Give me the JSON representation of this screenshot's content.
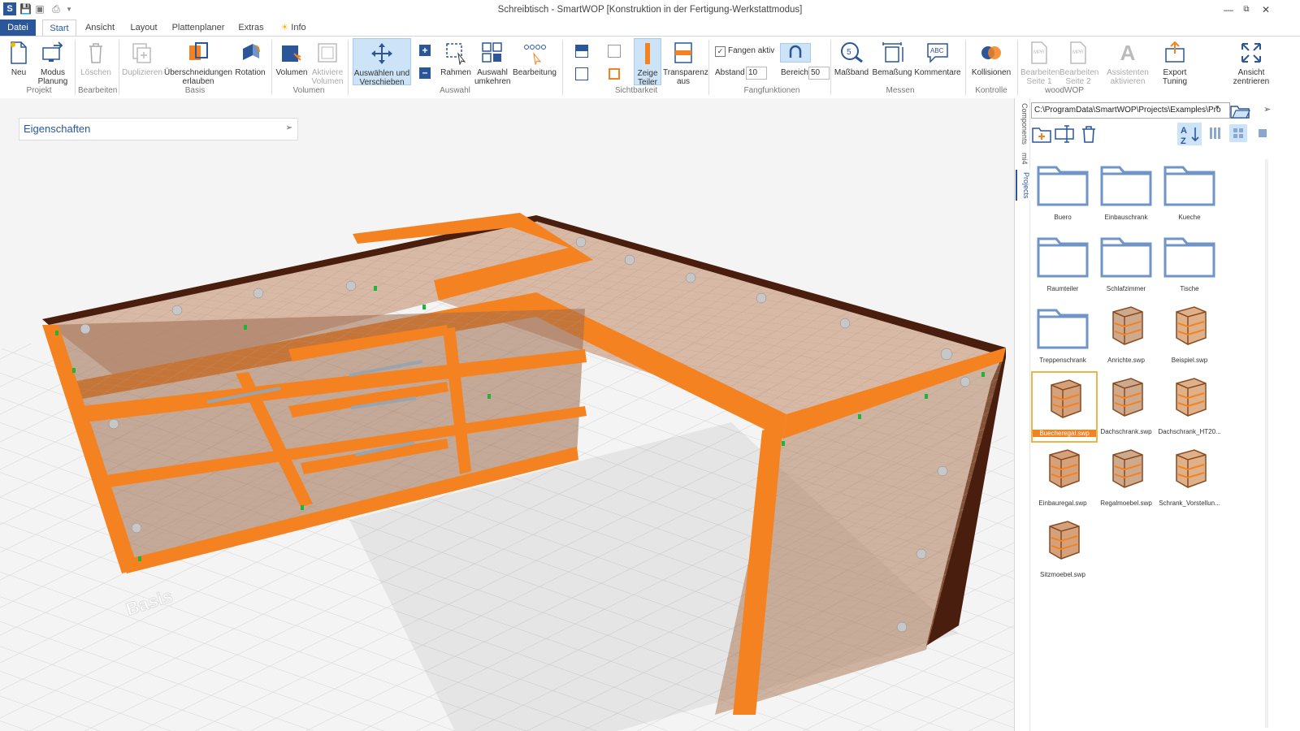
{
  "window": {
    "title": "Schreibtisch - SmartWOP [Konstruktion in der Fertigung-Werkstattmodus]"
  },
  "tabs": {
    "file": "Datei",
    "start": "Start",
    "view": "Ansicht",
    "layout": "Layout",
    "planner": "Plattenplaner",
    "extras": "Extras",
    "info": "Info"
  },
  "ribbon": {
    "new": "Neu",
    "mode_planning": "Modus\nPlanung",
    "delete": "Löschen",
    "duplicate": "Duplizieren",
    "allow_intersections": "Überschneidungen\nerlauben",
    "rotation": "Rotation",
    "volume": "Volumen",
    "activate_volume": "Aktiviere\nVolumen",
    "select_move": "Auswählen und\nVerschieben",
    "frame": "Rahmen",
    "invert_selection": "Auswahl\numkehren",
    "edit": "Bearbeitung",
    "show_parts": "Zeige\nTeiler",
    "transparency": "Transparenz\naus",
    "snap_active": "Fangen aktiv",
    "distance_label": "Abstand",
    "distance_value": "10",
    "range_label": "Bereich",
    "range_value": "50",
    "measuring_tape": "Maßband",
    "dimensioning": "Bemaßung",
    "comments": "Kommentare",
    "collisions": "Kollisionen",
    "edit_page1": "Bearbeiten\nSeite 1",
    "edit_page2": "Bearbeiten\nSeite 2",
    "assistants": "Assistenten\naktivieren",
    "export_tuning": "Export\nTuning",
    "center_view": "Ansicht\nzentrieren",
    "groups": {
      "project": "Projekt",
      "edit": "Bearbeiten",
      "basis": "Basis",
      "volume": "Volumen",
      "selection": "Auswahl",
      "visibility": "Sichtbarkeit",
      "snap": "Fangfunktionen",
      "measure": "Messen",
      "control": "Kontrolle",
      "woodwop": "woodWOP"
    }
  },
  "properties_panel": {
    "title": "Eigenschaften"
  },
  "viewport": {
    "watermark": "Basis"
  },
  "side_tabs": {
    "components": "Components",
    "mi4": "mi4",
    "projects": "Projects"
  },
  "file_browser": {
    "path": "C:\\ProgramData\\SmartWOP\\Projects\\Examples\\Pro",
    "items": [
      {
        "name": "Buero",
        "kind": "folder"
      },
      {
        "name": "Einbauschrank",
        "kind": "folder"
      },
      {
        "name": "Kueche",
        "kind": "folder"
      },
      {
        "name": "Raumteiler",
        "kind": "folder"
      },
      {
        "name": "Schlafzimmer",
        "kind": "folder"
      },
      {
        "name": "Tische",
        "kind": "folder"
      },
      {
        "name": "Treppenschrank",
        "kind": "folder"
      },
      {
        "name": "Anrichte.swp",
        "kind": "file"
      },
      {
        "name": "Beispiel.swp",
        "kind": "file"
      },
      {
        "name": "Buecheregal.swp",
        "kind": "file",
        "selected": true
      },
      {
        "name": "Dachschrank.swp",
        "kind": "file"
      },
      {
        "name": "Dachschrank_HT20...",
        "kind": "file"
      },
      {
        "name": "Einbauregal.swp",
        "kind": "file"
      },
      {
        "name": "Regalmoebel.swp",
        "kind": "file"
      },
      {
        "name": "Schrank_Vorstellun...",
        "kind": "file"
      },
      {
        "name": "Sitzmoebel.swp",
        "kind": "file"
      }
    ]
  },
  "colors": {
    "accent": "#2b579a",
    "orange": "#f58220",
    "dark_wood": "#4a1e0e"
  }
}
